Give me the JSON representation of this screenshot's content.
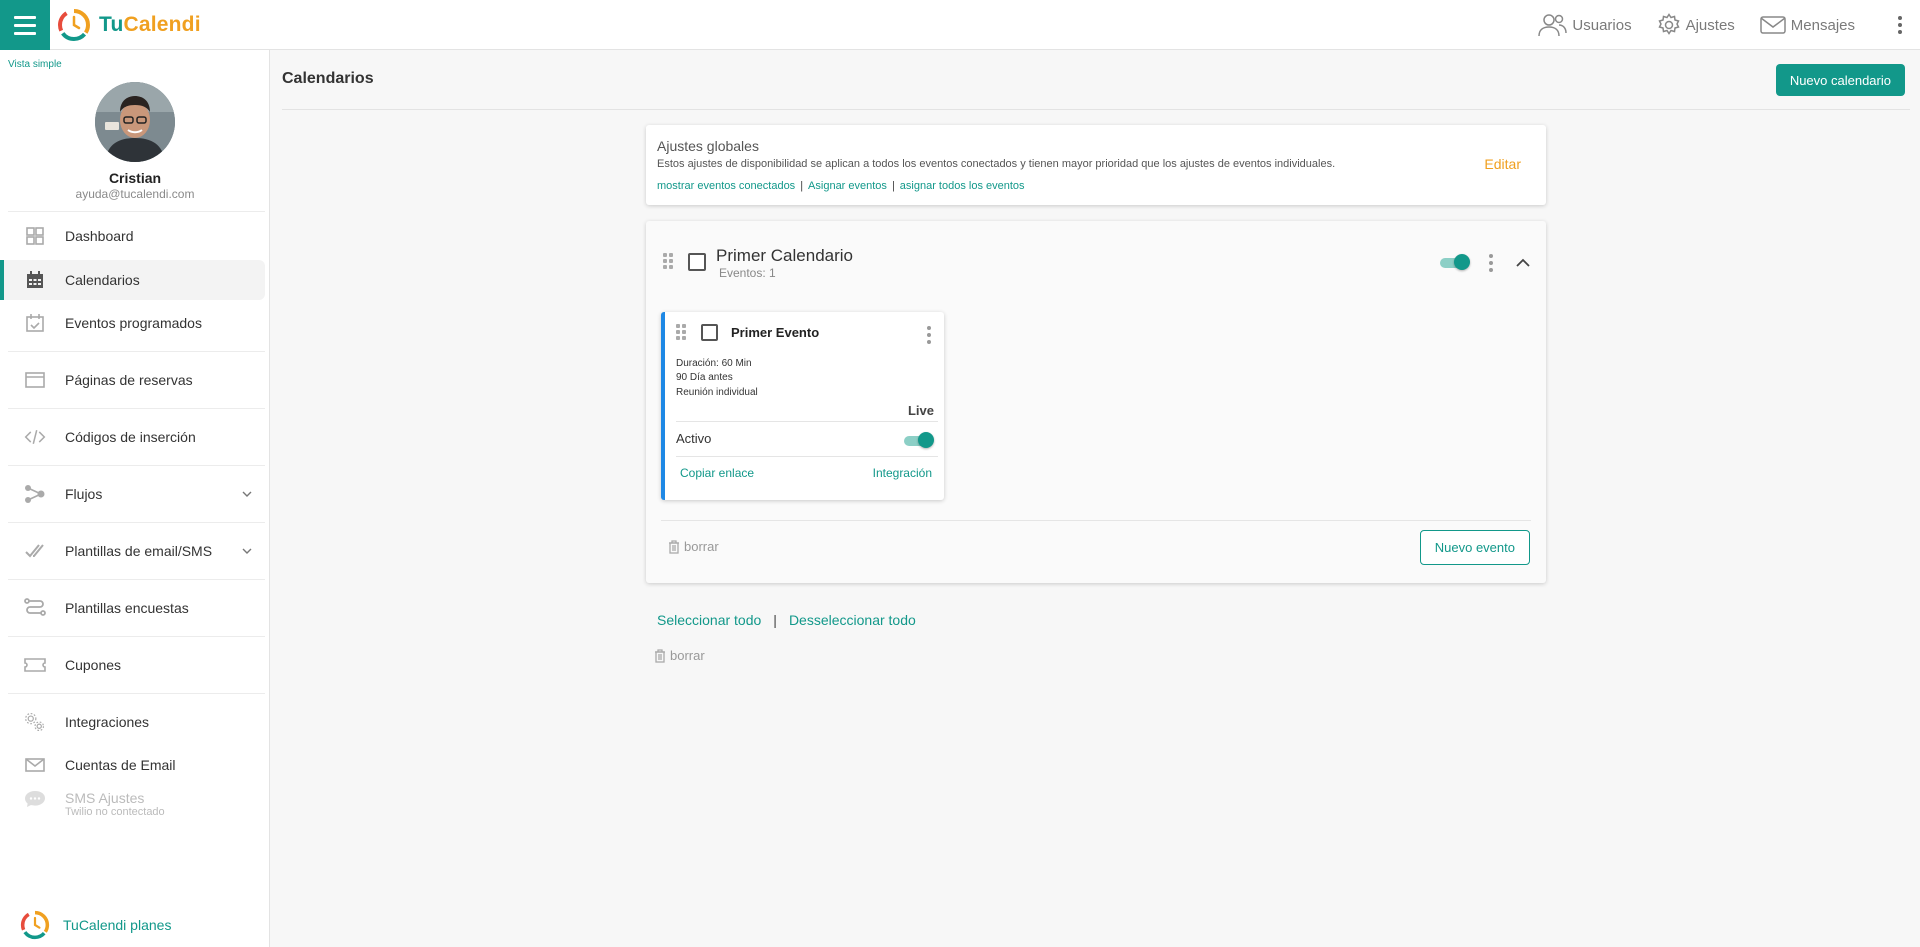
{
  "app": {
    "logo": {
      "part1": "Tu",
      "part2": "Calend",
      "part3": "i"
    },
    "colors": {
      "accent": "#12988a",
      "brand_orange": "#f0a020",
      "event_border": "#1e88e5"
    }
  },
  "topbar": {
    "menu_icon": "hamburger-icon",
    "links": [
      {
        "label": "Usuarios",
        "icon": "users-icon"
      },
      {
        "label": "Ajustes",
        "icon": "gear-icon"
      },
      {
        "label": "Mensajes",
        "icon": "envelope-icon"
      }
    ]
  },
  "sidebar": {
    "view_toggle": "Vista simple",
    "user": {
      "name": "Cristian",
      "email": "ayuda@tucalendi.com"
    },
    "items": [
      {
        "label": "Dashboard",
        "icon": "dashboard-icon"
      },
      {
        "label": "Calendarios",
        "icon": "calendar-icon",
        "active": true
      },
      {
        "label": "Eventos programados",
        "icon": "calendar-check-icon"
      },
      {
        "label": "Páginas de reservas",
        "icon": "browser-icon"
      },
      {
        "label": "Códigos de inserción",
        "icon": "code-icon"
      },
      {
        "label": "Flujos",
        "icon": "flows-icon",
        "expandable": true
      },
      {
        "label": "Plantillas de email/SMS",
        "icon": "double-check-icon",
        "expandable": true
      },
      {
        "label": "Plantillas encuestas",
        "icon": "route-icon"
      },
      {
        "label": "Cupones",
        "icon": "ticket-icon"
      },
      {
        "label": "Integraciones",
        "icon": "gears-icon"
      },
      {
        "label": "Cuentas de Email",
        "icon": "mail-icon"
      },
      {
        "label": "SMS Ajustes",
        "sublabel": "Twilio no contectado",
        "icon": "chat-icon",
        "disabled": true
      }
    ],
    "plans_label": "TuCalendi planes"
  },
  "main": {
    "title": "Calendarios",
    "new_calendar_label": "Nuevo calendario",
    "global_settings": {
      "title": "Ajustes globales",
      "description": "Estos ajustes de disponibilidad se aplican a todos los eventos conectados y tienen mayor prioridad que los ajustes de eventos individuales.",
      "links": [
        "mostrar eventos conectados",
        "Asignar eventos",
        "asignar todos los eventos"
      ],
      "edit_label": "Editar"
    },
    "calendar": {
      "title": "Primer Calendario",
      "events_count": "Eventos: 1",
      "enabled": true,
      "event": {
        "title": "Primer Evento",
        "duration": "Duración: 60 Min",
        "days_before": "90 Día antes",
        "type": "Reunión individual",
        "status": "Live",
        "active_label": "Activo",
        "active": true,
        "copy_link_label": "Copiar enlace",
        "integration_label": "Integración"
      },
      "delete_label": "borrar",
      "new_event_label": "Nuevo evento"
    },
    "select_all_label": "Seleccionar todo",
    "deselect_all_label": "Desseleccionar todo",
    "bulk_delete_label": "borrar"
  }
}
